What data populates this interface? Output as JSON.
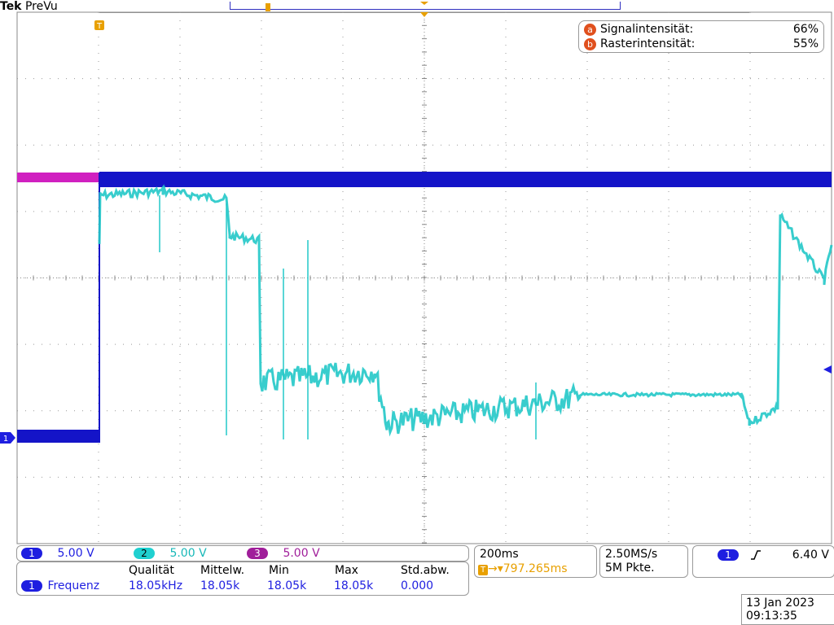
{
  "brand": {
    "tek": "Tek",
    "mode": "PreVu"
  },
  "intensity": {
    "signal": {
      "key": "a",
      "label": "Signalintensität:",
      "value": "66%"
    },
    "grid": {
      "key": "b",
      "label": "Rasterintensität:",
      "value": "55%"
    }
  },
  "channels": [
    {
      "num": "1",
      "scale": "5.00 V",
      "color": "#1e1ee0"
    },
    {
      "num": "2",
      "scale": "5.00 V",
      "color": "#20d0d0"
    },
    {
      "num": "3",
      "scale": "5.00 V",
      "color": "#a01e9a"
    }
  ],
  "trace_colors": {
    "ch1": "#1414c8",
    "ch2": "#22c8c8",
    "ch3": "#d020c0"
  },
  "markers": {
    "trigger": "T",
    "ch1_level": "1"
  },
  "measurements": {
    "headers": [
      "Qualität",
      "Mittelw.",
      "Min",
      "Max",
      "Std.abw."
    ],
    "channel": "1",
    "name": "Frequenz",
    "values": [
      "18.05kHz",
      "18.05k",
      "18.05k",
      "18.05k",
      "0.000"
    ]
  },
  "timebase": {
    "scale": "200ms",
    "position": "797.265ms"
  },
  "acquisition": {
    "rate": "2.50MS/s",
    "points": "5M Pkte."
  },
  "trigger": {
    "channel": "1",
    "slope_icon": "rising-edge-icon",
    "level": "6.40 V"
  },
  "datetime": {
    "date": "13 Jan 2023",
    "time": "09:13:35"
  }
}
